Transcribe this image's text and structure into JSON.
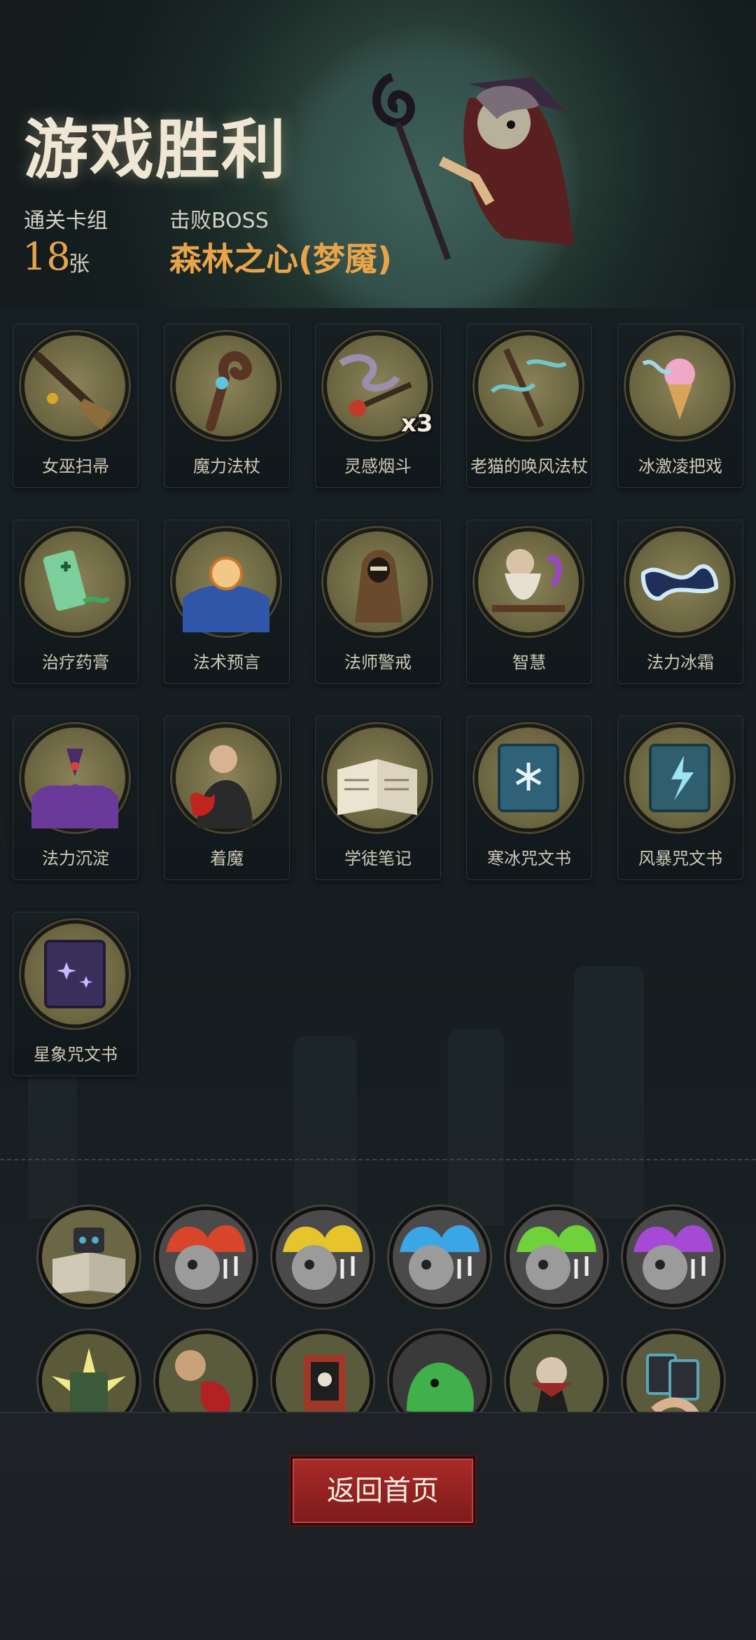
{
  "header": {
    "title": "游戏胜利",
    "deck_label": "通关卡组",
    "deck_count": "18",
    "deck_unit": "张",
    "boss_label": "击败BOSS",
    "boss_name": "森林之心(梦魇)"
  },
  "cards": [
    {
      "label": "女巫扫帚",
      "icon": "broom-icon"
    },
    {
      "label": "魔力法杖",
      "icon": "staff-icon"
    },
    {
      "label": "灵感烟斗",
      "icon": "pipe-icon",
      "badge": "x3"
    },
    {
      "label": "老猫的唤风法杖",
      "icon": "wind-staff-icon"
    },
    {
      "label": "冰激凌把戏",
      "icon": "ice-cream-icon"
    },
    {
      "label": "治疗药膏",
      "icon": "ointment-icon"
    },
    {
      "label": "法术预言",
      "icon": "crystal-orb-icon"
    },
    {
      "label": "法师警戒",
      "icon": "hooded-mage-icon"
    },
    {
      "label": "智慧",
      "icon": "old-sage-icon"
    },
    {
      "label": "法力冰霜",
      "icon": "frost-icon"
    },
    {
      "label": "法力沉淀",
      "icon": "mana-eye-icon"
    },
    {
      "label": "着魔",
      "icon": "possessed-icon"
    },
    {
      "label": "学徒笔记",
      "icon": "notebook-icon"
    },
    {
      "label": "寒冰咒文书",
      "icon": "ice-tome-icon"
    },
    {
      "label": "风暴咒文书",
      "icon": "storm-tome-icon"
    },
    {
      "label": "星象咒文书",
      "icon": "star-tome-icon"
    }
  ],
  "relics": [
    {
      "icon": "spellbook-relic-icon",
      "color": "#4fb0c8"
    },
    {
      "icon": "music-skull-red-icon",
      "color": "#d9452b"
    },
    {
      "icon": "music-skull-yellow-icon",
      "color": "#e6c42b"
    },
    {
      "icon": "music-skull-blue-icon",
      "color": "#3aa6e6"
    },
    {
      "icon": "music-skull-green-icon",
      "color": "#6fd23a"
    },
    {
      "icon": "music-skull-purple-icon",
      "color": "#a64ad6"
    },
    {
      "icon": "glowing-book-relic-icon",
      "color": "#e0d86a"
    },
    {
      "icon": "bleeding-hand-relic-icon",
      "color": "#b22222"
    },
    {
      "icon": "pirate-banner-relic-icon",
      "color": "#a03828"
    },
    {
      "icon": "green-ghost-relic-icon",
      "color": "#3fb04a"
    },
    {
      "icon": "vampire-relic-icon",
      "color": "#9a2a2a"
    },
    {
      "icon": "card-hand-relic-icon",
      "color": "#5aa6b8"
    }
  ],
  "footer": {
    "home_button": "返回首页"
  }
}
